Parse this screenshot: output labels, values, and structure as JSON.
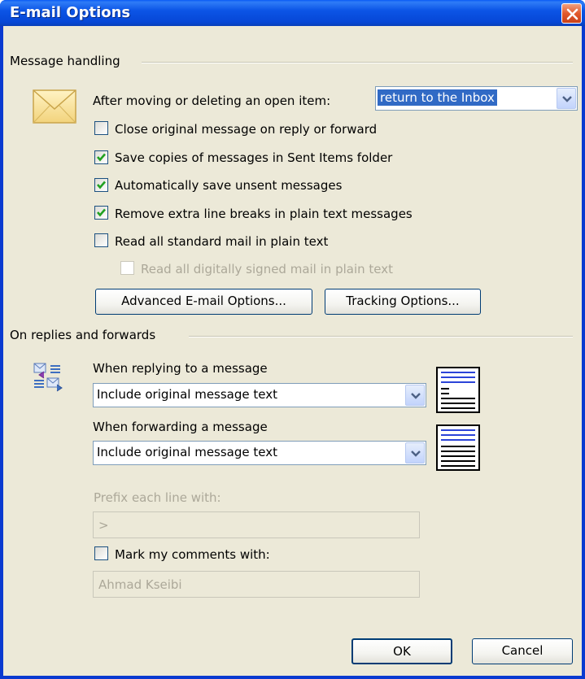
{
  "window": {
    "title": "E-mail Options"
  },
  "message_handling": {
    "group_label": "Message handling",
    "after_moving_label": "After moving or deleting an open item:",
    "after_moving_value": "return to the Inbox",
    "checkboxes": [
      {
        "label": "Close original message on reply or forward",
        "checked": false,
        "enabled": true
      },
      {
        "label": "Save copies of messages in Sent Items folder",
        "checked": true,
        "enabled": true
      },
      {
        "label": "Automatically save unsent messages",
        "checked": true,
        "enabled": true
      },
      {
        "label": "Remove extra line breaks in plain text messages",
        "checked": true,
        "enabled": true
      },
      {
        "label": "Read all standard mail in plain text",
        "checked": false,
        "enabled": true
      },
      {
        "label": "Read all digitally signed mail in plain text",
        "checked": false,
        "enabled": false
      }
    ],
    "advanced_button": "Advanced E-mail Options...",
    "tracking_button": "Tracking Options..."
  },
  "replies_forwards": {
    "group_label": "On replies and forwards",
    "replying_label": "When replying to a message",
    "replying_value": "Include original message text",
    "forwarding_label": "When forwarding a message",
    "forwarding_value": "Include original message text",
    "prefix_label": "Prefix each line with:",
    "prefix_value": ">",
    "mark_comments_label": "Mark my comments with:",
    "mark_comments_checked": false,
    "mark_comments_value": "Ahmad Kseibi"
  },
  "footer": {
    "ok_label": "OK",
    "cancel_label": "Cancel"
  },
  "colors": {
    "title_bar": "#0a5bf5",
    "dialog_bg": "#ece9d8",
    "check_green": "#21a121",
    "selection": "#316ac5"
  }
}
